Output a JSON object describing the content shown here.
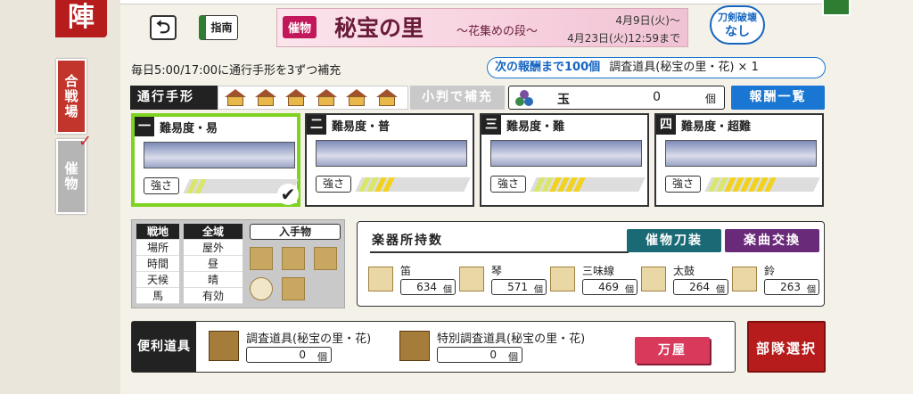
{
  "header": {
    "title": "陣",
    "tab_kassen": "合戦場",
    "tab_saibutsu": "催物"
  },
  "top": {
    "guide_label": "指南",
    "back_symbol": "⮌"
  },
  "banner": {
    "tag": "催物",
    "title": "秘宝の里",
    "subtitle": "〜花集めの段〜",
    "date_start": "4月9日(火)〜",
    "date_end": "4月23日(火)12:59まで"
  },
  "katana_badge": {
    "line1": "刀剣破壊",
    "line2": "なし"
  },
  "info": {
    "refill_note": "毎日5:00/17:00に通行手形を3ずつ補充",
    "next_reward_prefix": "次の報酬まで100個",
    "next_reward_item": "調査道具(秘宝の里・花) × 1"
  },
  "pass": {
    "label": "通行手形",
    "count": 6,
    "koban_label": "小判で補充"
  },
  "gem": {
    "label": "玉",
    "count": "0",
    "unit": "個"
  },
  "reward_list_label": "報酬一覧",
  "difficulties": [
    {
      "num": "一",
      "title": "難易度・易",
      "strength_label": "強さ",
      "level": 2,
      "selected": true
    },
    {
      "num": "二",
      "title": "難易度・普",
      "strength_label": "強さ",
      "level": 4,
      "selected": false
    },
    {
      "num": "三",
      "title": "難易度・難",
      "strength_label": "強さ",
      "level": 6,
      "selected": false
    },
    {
      "num": "四",
      "title": "難易度・超難",
      "strength_label": "強さ",
      "level": 8,
      "selected": false
    }
  ],
  "conditions": {
    "keys": [
      "戦地",
      "場所",
      "時間",
      "天候",
      "馬"
    ],
    "values": [
      "全域",
      "屋外",
      "昼",
      "晴",
      "有効"
    ],
    "acquire_label": "入手物"
  },
  "instruments": {
    "title": "楽器所持数",
    "weapon_btn": "催物刀装",
    "music_btn": "楽曲交換",
    "items": [
      {
        "name": "笛",
        "count": "634",
        "unit": "個"
      },
      {
        "name": "琴",
        "count": "571",
        "unit": "個"
      },
      {
        "name": "三味線",
        "count": "469",
        "unit": "個"
      },
      {
        "name": "太鼓",
        "count": "264",
        "unit": "個"
      },
      {
        "name": "鈴",
        "count": "263",
        "unit": "個"
      }
    ]
  },
  "tools": {
    "label": "便利道具",
    "items": [
      {
        "name": "調査道具(秘宝の里・花)",
        "count": "0",
        "unit": "個"
      },
      {
        "name": "特別調査道具(秘宝の里・花)",
        "count": "0",
        "unit": "個"
      }
    ]
  },
  "yorozu_label": "万屋",
  "squad_label": "部隊選択",
  "colors": {
    "selected": "#7ed321",
    "meter_on": "#f2d21b",
    "meter_low": "#d9e66a",
    "accent_blue": "#1976d2",
    "red": "#b71c1c"
  }
}
